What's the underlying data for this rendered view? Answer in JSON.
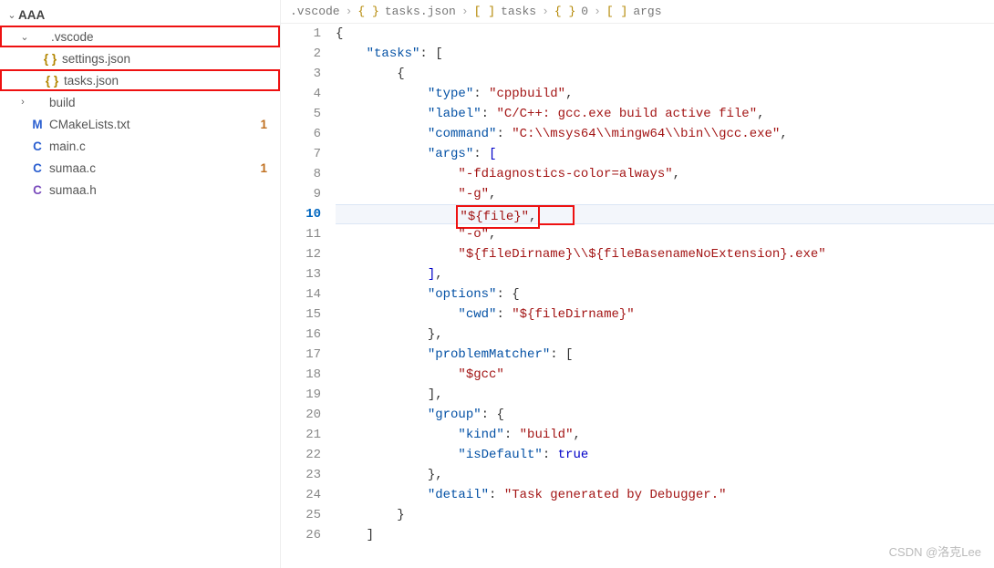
{
  "sidebar": {
    "root": "AAA",
    "items": [
      {
        "label": ".vscode",
        "kind": "folder",
        "expanded": true,
        "depth": 1,
        "highlight": true
      },
      {
        "label": "settings.json",
        "kind": "json",
        "depth": 2
      },
      {
        "label": "tasks.json",
        "kind": "json",
        "depth": 2,
        "highlight": true
      },
      {
        "label": "build",
        "kind": "folder",
        "expanded": false,
        "depth": 1
      },
      {
        "label": "CMakeLists.txt",
        "kind": "m",
        "depth": 1,
        "badge": "1"
      },
      {
        "label": "main.c",
        "kind": "c",
        "depth": 1
      },
      {
        "label": "sumaa.c",
        "kind": "c",
        "depth": 1,
        "badge": "1"
      },
      {
        "label": "sumaa.h",
        "kind": "cpp",
        "depth": 1
      }
    ]
  },
  "breadcrumb": {
    "parts": [
      {
        "icon": "",
        "label": ".vscode"
      },
      {
        "icon": "{ }",
        "label": "tasks.json"
      },
      {
        "icon": "[ ]",
        "label": "tasks"
      },
      {
        "icon": "{ }",
        "label": "0"
      },
      {
        "icon": "[ ]",
        "label": "args"
      }
    ],
    "sep": "›"
  },
  "editor": {
    "current_line": 10,
    "lines": [
      {
        "n": 1,
        "indent": 0,
        "tokens": [
          {
            "t": "{",
            "c": "pun"
          }
        ]
      },
      {
        "n": 2,
        "indent": 1,
        "tokens": [
          {
            "t": "\"tasks\"",
            "c": "key"
          },
          {
            "t": ": [",
            "c": "pun"
          }
        ]
      },
      {
        "n": 3,
        "indent": 2,
        "tokens": [
          {
            "t": "{",
            "c": "pun"
          }
        ]
      },
      {
        "n": 4,
        "indent": 3,
        "tokens": [
          {
            "t": "\"type\"",
            "c": "key"
          },
          {
            "t": ": ",
            "c": "pun"
          },
          {
            "t": "\"cppbuild\"",
            "c": "str"
          },
          {
            "t": ",",
            "c": "pun"
          }
        ]
      },
      {
        "n": 5,
        "indent": 3,
        "tokens": [
          {
            "t": "\"label\"",
            "c": "key"
          },
          {
            "t": ": ",
            "c": "pun"
          },
          {
            "t": "\"C/C++: gcc.exe build active file\"",
            "c": "str"
          },
          {
            "t": ",",
            "c": "pun"
          }
        ]
      },
      {
        "n": 6,
        "indent": 3,
        "tokens": [
          {
            "t": "\"command\"",
            "c": "key"
          },
          {
            "t": ": ",
            "c": "pun"
          },
          {
            "t": "\"C:\\\\msys64\\\\mingw64\\\\bin\\\\gcc.exe\"",
            "c": "str"
          },
          {
            "t": ",",
            "c": "pun"
          }
        ]
      },
      {
        "n": 7,
        "indent": 3,
        "tokens": [
          {
            "t": "\"args\"",
            "c": "key"
          },
          {
            "t": ": ",
            "c": "pun"
          },
          {
            "t": "[",
            "c": "kw"
          }
        ]
      },
      {
        "n": 8,
        "indent": 4,
        "tokens": [
          {
            "t": "\"-fdiagnostics-color=always\"",
            "c": "str"
          },
          {
            "t": ",",
            "c": "pun"
          }
        ]
      },
      {
        "n": 9,
        "indent": 4,
        "tokens": [
          {
            "t": "\"-g\"",
            "c": "str"
          },
          {
            "t": ",",
            "c": "pun"
          }
        ]
      },
      {
        "n": 10,
        "indent": 4,
        "highlight": true,
        "tokens": [
          {
            "t": "\"${file}\"",
            "c": "str"
          },
          {
            "t": ",",
            "c": "pun"
          }
        ]
      },
      {
        "n": 11,
        "indent": 4,
        "tokens": [
          {
            "t": "\"-o\"",
            "c": "str"
          },
          {
            "t": ",",
            "c": "pun"
          }
        ]
      },
      {
        "n": 12,
        "indent": 4,
        "tokens": [
          {
            "t": "\"${fileDirname}\\\\${fileBasenameNoExtension}.exe\"",
            "c": "str"
          }
        ]
      },
      {
        "n": 13,
        "indent": 3,
        "tokens": [
          {
            "t": "]",
            "c": "kw"
          },
          {
            "t": ",",
            "c": "pun"
          }
        ]
      },
      {
        "n": 14,
        "indent": 3,
        "tokens": [
          {
            "t": "\"options\"",
            "c": "key"
          },
          {
            "t": ": {",
            "c": "pun"
          }
        ]
      },
      {
        "n": 15,
        "indent": 4,
        "tokens": [
          {
            "t": "\"cwd\"",
            "c": "key"
          },
          {
            "t": ": ",
            "c": "pun"
          },
          {
            "t": "\"${fileDirname}\"",
            "c": "str"
          }
        ]
      },
      {
        "n": 16,
        "indent": 3,
        "tokens": [
          {
            "t": "},",
            "c": "pun"
          }
        ]
      },
      {
        "n": 17,
        "indent": 3,
        "tokens": [
          {
            "t": "\"problemMatcher\"",
            "c": "key"
          },
          {
            "t": ": [",
            "c": "pun"
          }
        ]
      },
      {
        "n": 18,
        "indent": 4,
        "tokens": [
          {
            "t": "\"$gcc\"",
            "c": "str"
          }
        ]
      },
      {
        "n": 19,
        "indent": 3,
        "tokens": [
          {
            "t": "],",
            "c": "pun"
          }
        ]
      },
      {
        "n": 20,
        "indent": 3,
        "tokens": [
          {
            "t": "\"group\"",
            "c": "key"
          },
          {
            "t": ": {",
            "c": "pun"
          }
        ]
      },
      {
        "n": 21,
        "indent": 4,
        "tokens": [
          {
            "t": "\"kind\"",
            "c": "key"
          },
          {
            "t": ": ",
            "c": "pun"
          },
          {
            "t": "\"build\"",
            "c": "str"
          },
          {
            "t": ",",
            "c": "pun"
          }
        ]
      },
      {
        "n": 22,
        "indent": 4,
        "tokens": [
          {
            "t": "\"isDefault\"",
            "c": "key"
          },
          {
            "t": ": ",
            "c": "pun"
          },
          {
            "t": "true",
            "c": "kw"
          }
        ]
      },
      {
        "n": 23,
        "indent": 3,
        "tokens": [
          {
            "t": "},",
            "c": "pun"
          }
        ]
      },
      {
        "n": 24,
        "indent": 3,
        "tokens": [
          {
            "t": "\"detail\"",
            "c": "key"
          },
          {
            "t": ": ",
            "c": "pun"
          },
          {
            "t": "\"Task generated by Debugger.\"",
            "c": "str"
          }
        ]
      },
      {
        "n": 25,
        "indent": 2,
        "tokens": [
          {
            "t": "}",
            "c": "pun"
          }
        ]
      },
      {
        "n": 26,
        "indent": 1,
        "tokens": [
          {
            "t": "]",
            "c": "pun"
          }
        ]
      }
    ]
  },
  "watermark": "CSDN @洛克Lee"
}
